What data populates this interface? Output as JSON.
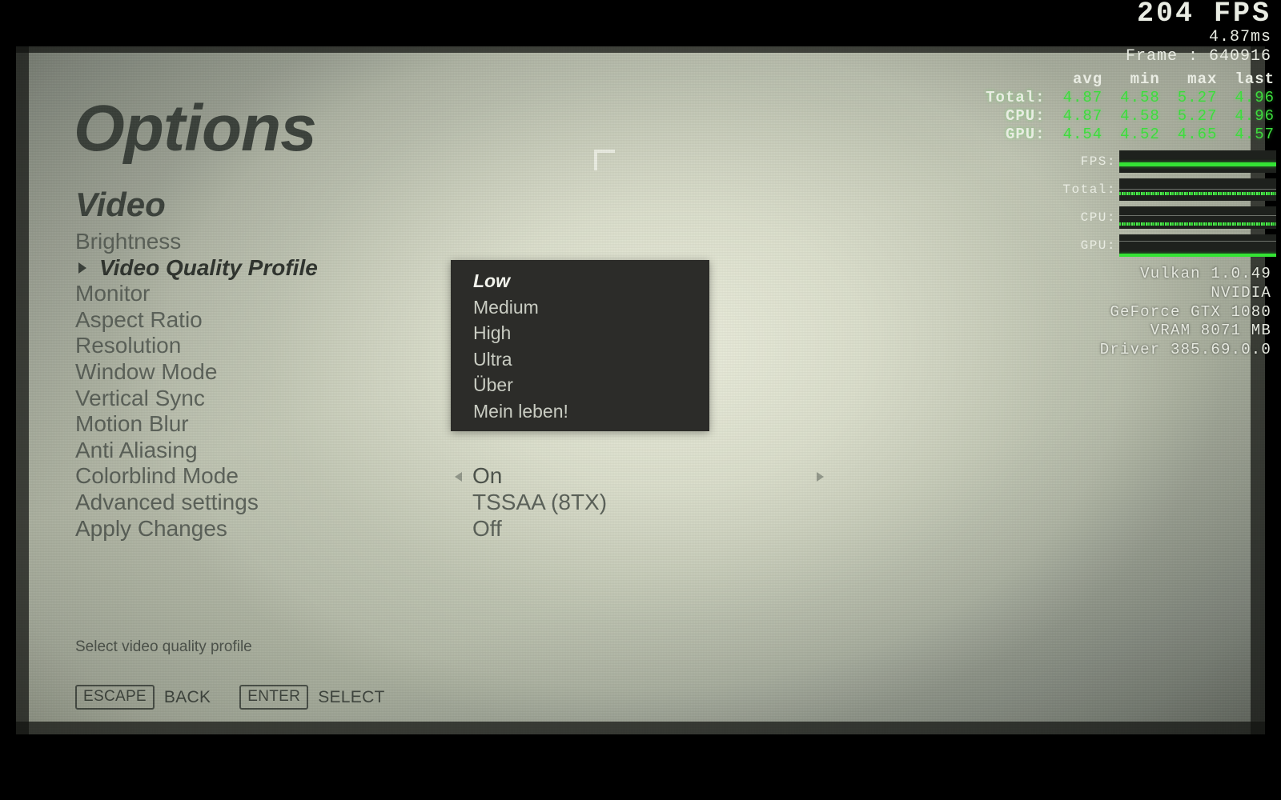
{
  "app": {
    "title": "Options",
    "section": "Video"
  },
  "menu": {
    "items": [
      {
        "label": "Brightness",
        "selected": false
      },
      {
        "label": "Video Quality Profile",
        "selected": true
      },
      {
        "label": "Monitor",
        "selected": false
      },
      {
        "label": "Aspect Ratio",
        "selected": false
      },
      {
        "label": "Resolution",
        "selected": false
      },
      {
        "label": "Window Mode",
        "selected": false
      },
      {
        "label": "Vertical Sync",
        "selected": false
      },
      {
        "label": "Motion Blur",
        "selected": false
      },
      {
        "label": "Anti Aliasing",
        "selected": false
      },
      {
        "label": "Colorblind Mode",
        "selected": false
      },
      {
        "label": "Advanced settings",
        "selected": false
      },
      {
        "label": "Apply Changes",
        "selected": false
      }
    ]
  },
  "values": {
    "rows": [
      {
        "text": "On",
        "arrows": true
      },
      {
        "text": "TSSAA (8TX)",
        "arrows": false
      },
      {
        "text": "Off",
        "arrows": false
      }
    ]
  },
  "dropdown": {
    "open": true,
    "options": [
      {
        "label": "Low",
        "current": true
      },
      {
        "label": "Medium",
        "current": false
      },
      {
        "label": "High",
        "current": false
      },
      {
        "label": "Ultra",
        "current": false
      },
      {
        "label": "Über",
        "current": false
      },
      {
        "label": "Mein leben!",
        "current": false
      }
    ]
  },
  "footer": {
    "hint": "Select video quality profile",
    "keys": [
      {
        "cap": "ESCAPE",
        "action": "BACK"
      },
      {
        "cap": "ENTER",
        "action": "SELECT"
      }
    ]
  },
  "perf": {
    "fps": "204 FPS",
    "frametime": "4.87ms",
    "frame_counter": "Frame : 640916",
    "columns": [
      "avg",
      "min",
      "max",
      "last"
    ],
    "rows": [
      {
        "label": "Total:",
        "avg": "4.87",
        "min": "4.58",
        "max": "5.27",
        "last": "4.96"
      },
      {
        "label": "CPU:",
        "avg": "4.87",
        "min": "4.58",
        "max": "5.27",
        "last": "4.96"
      },
      {
        "label": "GPU:",
        "avg": "4.54",
        "min": "4.52",
        "max": "4.65",
        "last": "4.57"
      }
    ],
    "graphs": [
      {
        "label": "FPS:"
      },
      {
        "label": "Total:"
      },
      {
        "label": "CPU:"
      },
      {
        "label": "GPU:"
      }
    ],
    "system": [
      "Vulkan 1.0.49",
      "NVIDIA",
      "GeForce GTX 1080",
      "VRAM 8071 MB",
      "Driver 385.69.0.0"
    ],
    "colors": {
      "graph_green": "#34e334",
      "overlay_text": "#e9ece3",
      "graph_background": "#1e211d"
    }
  },
  "theme": {
    "menu_text": "#5b6159",
    "menu_selected_text": "#2f342e",
    "title_text": "#3c423c",
    "dropdown_background": "#2c2c29",
    "dropdown_text": "#c9ccc2"
  }
}
